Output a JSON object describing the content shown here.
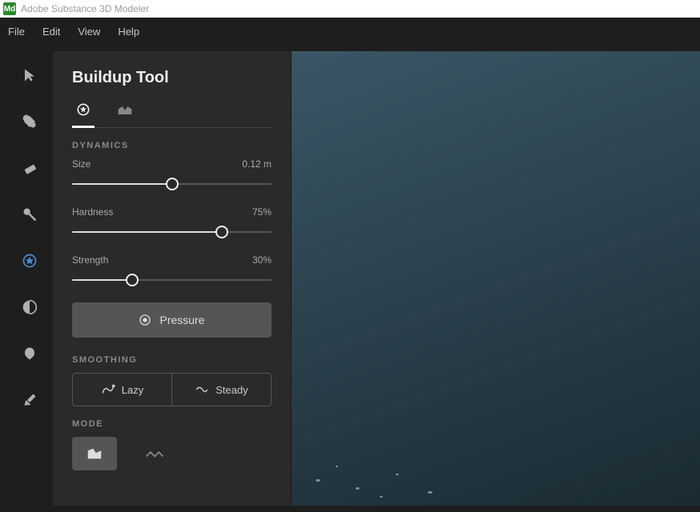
{
  "window": {
    "badge": "Md",
    "title": "Adobe Substance 3D Modeler"
  },
  "menubar": {
    "items": [
      "File",
      "Edit",
      "View",
      "Help"
    ]
  },
  "toolbar": {
    "tools": [
      {
        "name": "select-tool-icon",
        "active": false
      },
      {
        "name": "clay-tool-icon",
        "active": false
      },
      {
        "name": "erase-tool-icon",
        "active": false
      },
      {
        "name": "smooth-tool-icon",
        "active": false
      },
      {
        "name": "buildup-tool-icon",
        "active": true
      },
      {
        "name": "crease-tool-icon",
        "active": false
      },
      {
        "name": "inflate-tool-icon",
        "active": false
      },
      {
        "name": "paint-tool-icon",
        "active": false
      }
    ]
  },
  "panel": {
    "title": "Buildup Tool",
    "tabs": [
      {
        "name": "clay-tab",
        "active": true
      },
      {
        "name": "shape-tab",
        "active": false
      }
    ],
    "dynamics": {
      "label": "DYNAMICS",
      "size": {
        "label": "Size",
        "value": "0.12 m",
        "percent": 50
      },
      "hardness": {
        "label": "Hardness",
        "value": "75%",
        "percent": 75
      },
      "strength": {
        "label": "Strength",
        "value": "30%",
        "percent": 30
      },
      "pressure_label": "Pressure"
    },
    "smoothing": {
      "label": "SMOOTHING",
      "lazy": "Lazy",
      "steady": "Steady"
    },
    "mode": {
      "label": "MODE"
    }
  }
}
